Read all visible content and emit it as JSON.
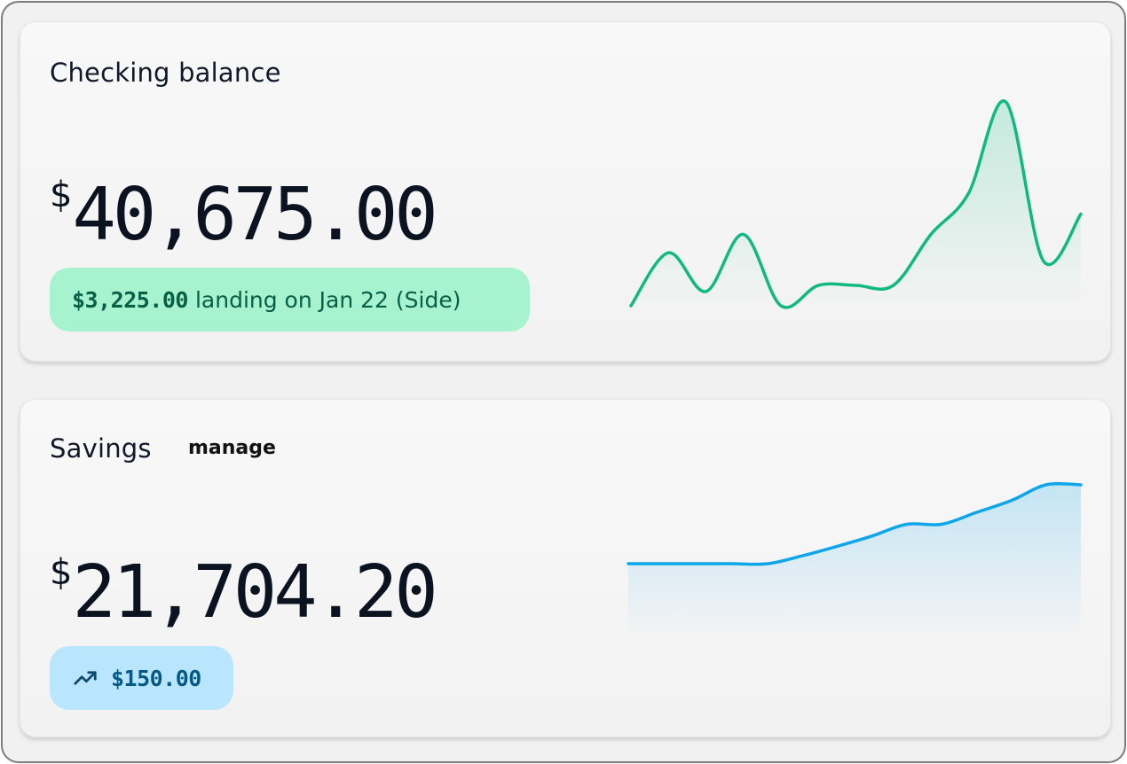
{
  "checking": {
    "title": "Checking balance",
    "currency_symbol": "$",
    "amount": "40,675.00",
    "pending_amount": "$3,225.00",
    "pending_text": "landing on Jan 22 (Side)",
    "chart_color": "#10b981",
    "trend": [
      0.0,
      0.26,
      0.07,
      0.35,
      0.0,
      0.1,
      0.1,
      0.1,
      0.35,
      0.55,
      1.0,
      0.22,
      0.45
    ]
  },
  "savings": {
    "title": "Savings",
    "manage_label": "manage",
    "currency_symbol": "$",
    "amount": "21,704.20",
    "change_icon": "trending-up-icon",
    "change_amount": "$150.00",
    "chart_color": "#0ea5e9",
    "trend": [
      0.0,
      0.0,
      0.0,
      0.0,
      0.0,
      0.1,
      0.22,
      0.35,
      0.5,
      0.5,
      0.65,
      0.8,
      1.0,
      1.0
    ]
  }
}
